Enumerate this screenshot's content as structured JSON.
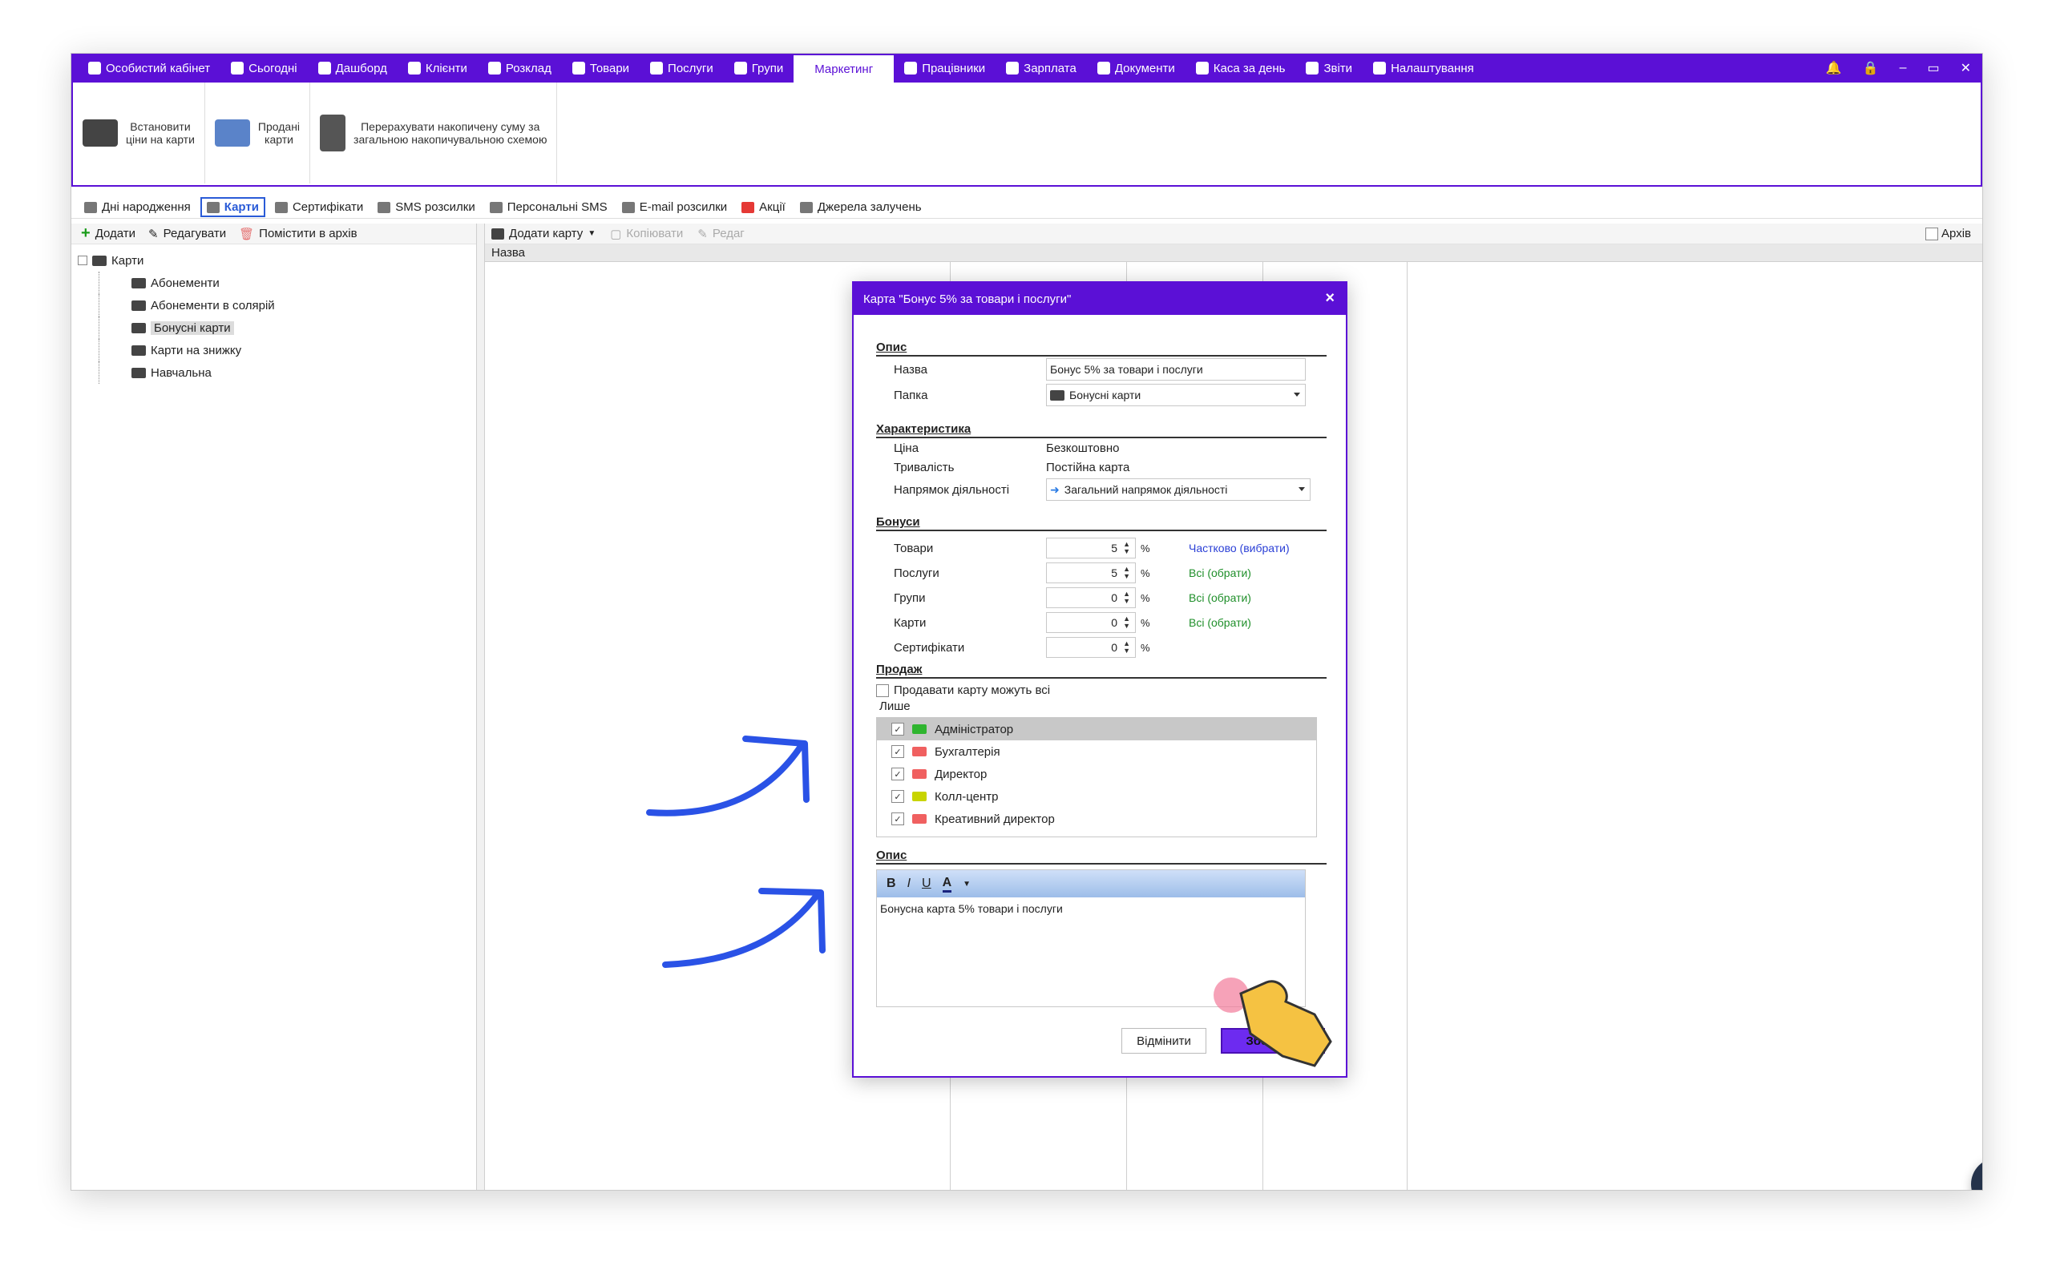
{
  "topnav": {
    "items": [
      {
        "label": "Особистий кабінет",
        "icon": "briefcase-icon"
      },
      {
        "label": "Сьогодні",
        "icon": "clock-icon"
      },
      {
        "label": "Дашборд",
        "icon": "pulse-icon"
      },
      {
        "label": "Клієнти",
        "icon": "user-circle-icon"
      },
      {
        "label": "Розклад",
        "icon": "calendar-icon"
      },
      {
        "label": "Товари",
        "icon": "box-icon"
      },
      {
        "label": "Послуги",
        "icon": "bolt-icon"
      },
      {
        "label": "Групи",
        "icon": "group-icon"
      },
      {
        "label": "Маркетинг",
        "icon": "",
        "active": true
      },
      {
        "label": "Працівники",
        "icon": "person-icon"
      },
      {
        "label": "Зарплата",
        "icon": "money-icon"
      },
      {
        "label": "Документи",
        "icon": "document-icon"
      },
      {
        "label": "Каса за день",
        "icon": "calculator-icon"
      },
      {
        "label": "Звіти",
        "icon": "bar-chart-icon"
      },
      {
        "label": "Налаштування",
        "icon": "gear-icon"
      }
    ],
    "window_controls": [
      "bell-icon",
      "lock-icon",
      "minimize-icon",
      "restore-icon",
      "close-icon"
    ]
  },
  "ribbon": {
    "set_prices": "Встановити\nціни на карти",
    "sold_cards": "Продані\nкарти",
    "recalc": "Перерахувати накопичену суму за\nзагальною накопичувальною схемою"
  },
  "subtabs": [
    {
      "label": "Дні народження",
      "icon": "cake-icon"
    },
    {
      "label": "Карти",
      "icon": "card-icon",
      "active": true
    },
    {
      "label": "Сертифікати",
      "icon": "certificate-icon"
    },
    {
      "label": "SMS розсилки",
      "icon": "chat-icon"
    },
    {
      "label": "Персональні SMS",
      "icon": "chat-icon"
    },
    {
      "label": "E-mail розсилки",
      "icon": "mail-icon"
    },
    {
      "label": "Акції",
      "icon": "heart-icon"
    },
    {
      "label": "Джерела залучень",
      "icon": "source-icon"
    }
  ],
  "left_toolbar": {
    "add": "Додати",
    "edit": "Редагувати",
    "archive": "Помістити в архів"
  },
  "tree": {
    "root": "Карти",
    "children": [
      "Абонементи",
      "Абонементи в солярій",
      "Бонусні карти",
      "Карти на знижку",
      "Навчальна"
    ],
    "selected": "Бонусні карти"
  },
  "right_toolbar": {
    "add_card": "Додати карту",
    "copy": "Копіювати",
    "edit": "Редаг",
    "archive_label": "Архів"
  },
  "grid": {
    "col_name": "Назва"
  },
  "dialog": {
    "title": "Карта \"Бонус 5% за товари і послуги\"",
    "sec_desc": "Опис",
    "name_label": "Назва",
    "name_value": "Бонус 5% за товари і послуги",
    "folder_label": "Папка",
    "folder_value": "Бонусні карти",
    "sec_char": "Характеристика",
    "price_label": "Ціна",
    "price_value": "Безкоштовно",
    "duration_label": "Тривалість",
    "duration_value": "Постійна карта",
    "direction_label": "Напрямок діяльності",
    "direction_value": "Загальний напрямок діяльності",
    "sec_bonus": "Бонуси",
    "bonuses": [
      {
        "label": "Товари",
        "value": "5",
        "unit": "%",
        "link": "Частково (вибрати)",
        "link_color": "blue"
      },
      {
        "label": "Послуги",
        "value": "5",
        "unit": "%",
        "link": "Всі (обрати)",
        "link_color": "green"
      },
      {
        "label": "Групи",
        "value": "0",
        "unit": "%",
        "link": "Всі (обрати)",
        "link_color": "green"
      },
      {
        "label": "Карти",
        "value": "0",
        "unit": "%",
        "link": "Всі (обрати)",
        "link_color": "green"
      },
      {
        "label": "Сертифікати",
        "value": "0",
        "unit": "%",
        "link": "",
        "link_color": ""
      }
    ],
    "sec_sale": "Продаж",
    "sell_all": "Продавати карту можуть всі",
    "only": "Лише",
    "roles": [
      {
        "name": "Адміністратор",
        "color": "#2fb52f",
        "selected": true
      },
      {
        "name": "Бухгалтерія",
        "color": "#f06060",
        "selected": false
      },
      {
        "name": "Директор",
        "color": "#f06060",
        "selected": false
      },
      {
        "name": "Колл-центр",
        "color": "#c8d400",
        "selected": false
      },
      {
        "name": "Креативний директор",
        "color": "#f06060",
        "selected": false
      }
    ],
    "sec_desc2": "Опис",
    "editor_text": "Бонусна карта 5% товари і послуги",
    "cancel": "Відмінити",
    "save": "Зберегти"
  }
}
